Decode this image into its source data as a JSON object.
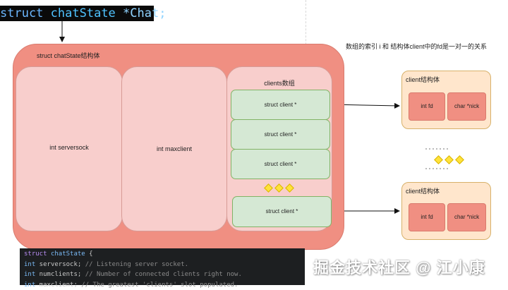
{
  "code_top": {
    "kw": "struct",
    "type": "chatState",
    "rest": " *Chat;"
  },
  "outer": {
    "label": "struct chatState结构体"
  },
  "panels": {
    "serversock": "int serversock",
    "maxclient": "int maxclient",
    "clients": "clients数组"
  },
  "client_cells": [
    "struct client *",
    "struct client *",
    "struct client *",
    "struct client *"
  ],
  "note": "数组的索引 i 和 结构体client中的fd是一对一的关系",
  "client_boxes": [
    {
      "title": "client结构体",
      "fd": "int fd",
      "nick": "char *nick"
    },
    {
      "title": "client结构体",
      "fd": "int fd",
      "nick": "char *nick"
    }
  ],
  "code_bottom": {
    "line1": {
      "kw": "struct",
      "type": "chatState",
      "rest": " {"
    },
    "line2": {
      "type": "int",
      "name": " serversock;",
      "comment": " // Listening server socket."
    },
    "line3": {
      "type": "int",
      "name": " numclients;",
      "comment": " // Number of connected clients right now."
    },
    "line4": {
      "type": "int",
      "name": " maxclient;",
      "comment": " // The greatest 'clients' slot populated."
    }
  },
  "watermark": "掘金技术社区 @ 江小康",
  "colors": {
    "outer": "#f08f82",
    "panel": "#f8cecc",
    "cell": "#d5e8d4",
    "client_box": "#ffe6cc",
    "diamond": "#ffe23a"
  }
}
